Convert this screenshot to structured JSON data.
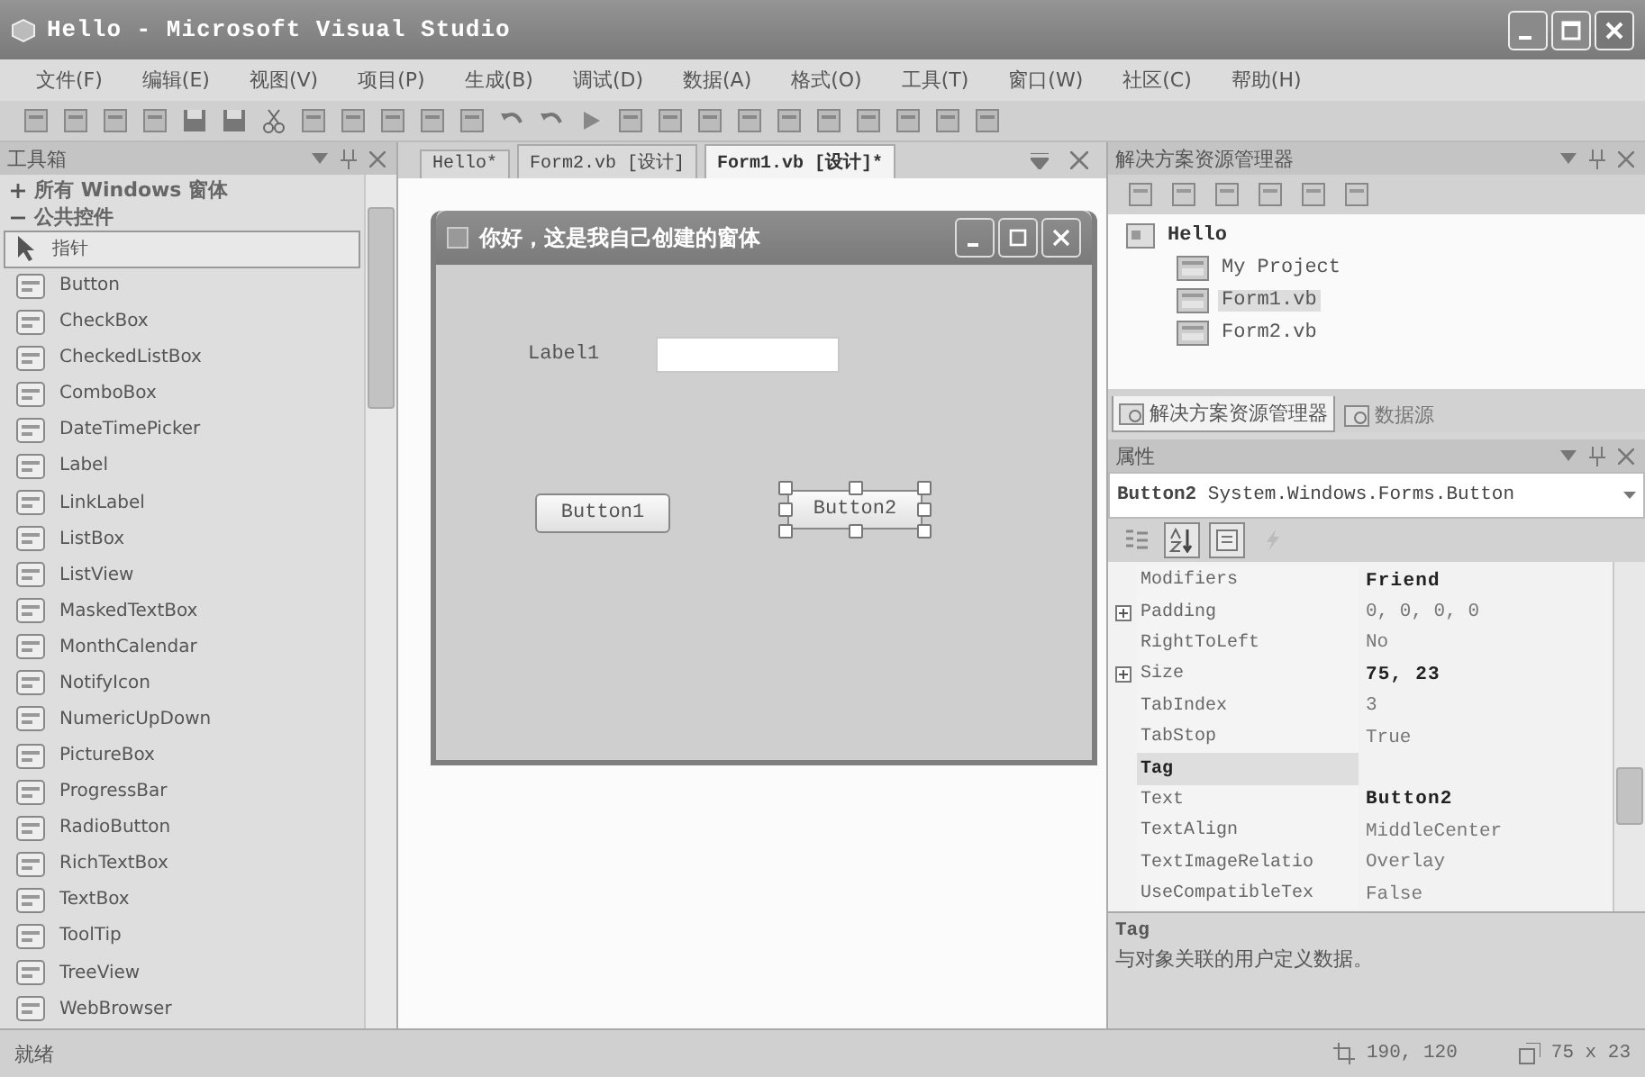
{
  "window": {
    "title": "Hello - Microsoft Visual Studio"
  },
  "menu": [
    "文件(F)",
    "编辑(E)",
    "视图(V)",
    "项目(P)",
    "生成(B)",
    "调试(D)",
    "数据(A)",
    "格式(O)",
    "工具(T)",
    "窗口(W)",
    "社区(C)",
    "帮助(H)"
  ],
  "toolbox": {
    "title": "工具箱",
    "groups": [
      {
        "label": "所有 Windows 窗体",
        "expanded": false
      },
      {
        "label": "公共控件",
        "expanded": true,
        "items": [
          {
            "label": "指针",
            "kind": "pointer",
            "selected": true
          },
          {
            "label": "Button",
            "kind": "control",
            "selected": false
          },
          {
            "label": "CheckBox",
            "kind": "control",
            "selected": false
          },
          {
            "label": "CheckedListBox",
            "kind": "control",
            "selected": false
          },
          {
            "label": "ComboBox",
            "kind": "control",
            "selected": false
          },
          {
            "label": "DateTimePicker",
            "kind": "control",
            "selected": false
          },
          {
            "label": "Label",
            "kind": "control",
            "selected": false
          },
          {
            "label": "LinkLabel",
            "kind": "control",
            "selected": false
          },
          {
            "label": "ListBox",
            "kind": "control",
            "selected": false
          },
          {
            "label": "ListView",
            "kind": "control",
            "selected": false
          },
          {
            "label": "MaskedTextBox",
            "kind": "control",
            "selected": false
          },
          {
            "label": "MonthCalendar",
            "kind": "control",
            "selected": false
          },
          {
            "label": "NotifyIcon",
            "kind": "control",
            "selected": false
          },
          {
            "label": "NumericUpDown",
            "kind": "control",
            "selected": false
          },
          {
            "label": "PictureBox",
            "kind": "control",
            "selected": false
          },
          {
            "label": "ProgressBar",
            "kind": "control",
            "selected": false
          },
          {
            "label": "RadioButton",
            "kind": "control",
            "selected": false
          },
          {
            "label": "RichTextBox",
            "kind": "control",
            "selected": false
          },
          {
            "label": "TextBox",
            "kind": "control",
            "selected": false
          },
          {
            "label": "ToolTip",
            "kind": "control",
            "selected": false
          },
          {
            "label": "TreeView",
            "kind": "control",
            "selected": false
          },
          {
            "label": "WebBrowser",
            "kind": "control",
            "selected": false
          }
        ]
      }
    ]
  },
  "tabs": [
    {
      "label": "Hello*",
      "selected": false
    },
    {
      "label": "Form2.vb [设计]",
      "selected": false
    },
    {
      "label": "Form1.vb [设计]*",
      "selected": true
    }
  ],
  "form": {
    "title": "你好，这是我自己创建的窗体",
    "controls": [
      {
        "kind": "label",
        "text": "Label1",
        "selected": false
      },
      {
        "kind": "textbox",
        "selected": false
      },
      {
        "kind": "button",
        "text": "Button1",
        "selected": false
      },
      {
        "kind": "button",
        "text": "Button2",
        "selected": true
      }
    ]
  },
  "solution_explorer": {
    "title": "解决方案资源管理器",
    "tree": [
      {
        "label": "Hello",
        "selected": false,
        "children": [
          {
            "label": "My Project",
            "selected": false
          },
          {
            "label": "Form1.vb",
            "selected": true
          },
          {
            "label": "Form2.vb",
            "selected": false
          }
        ]
      }
    ]
  },
  "panel_tabs": [
    {
      "label": "解决方案资源管理器",
      "selected": true
    },
    {
      "label": "数据源",
      "selected": false
    }
  ],
  "properties": {
    "title": "属性",
    "object": "**Button2** System.Windows.Forms.Button",
    "view_buttons": [
      {
        "kind": "categorized",
        "selected": false
      },
      {
        "kind": "alphabetical",
        "selected": true
      },
      {
        "kind": "properties",
        "selected": true
      },
      {
        "kind": "events",
        "selected": false
      }
    ],
    "rows": [
      {
        "name": "Modifiers",
        "value": "Friend",
        "expandable": false,
        "modified": true,
        "selected": false
      },
      {
        "name": "Padding",
        "value": "0, 0, 0, 0",
        "expandable": true,
        "modified": false,
        "selected": false
      },
      {
        "name": "RightToLeft",
        "value": "No",
        "expandable": false,
        "modified": false,
        "selected": false
      },
      {
        "name": "Size",
        "value": "75, 23",
        "expandable": true,
        "modified": true,
        "selected": false
      },
      {
        "name": "TabIndex",
        "value": "3",
        "expandable": false,
        "modified": false,
        "selected": false
      },
      {
        "name": "TabStop",
        "value": "True",
        "expandable": false,
        "modified": false,
        "selected": false
      },
      {
        "name": "Tag",
        "expandable": false,
        "selected": true
      },
      {
        "name": "Text",
        "value": "Button2",
        "expandable": false,
        "modified": true,
        "selected": false
      },
      {
        "name": "TextAlign",
        "value": "MiddleCenter",
        "expandable": false,
        "modified": false,
        "selected": false
      },
      {
        "name": "TextImageRelatio",
        "value": "Overlay",
        "expandable": false,
        "modified": false,
        "selected": false
      },
      {
        "name": "UseCompatibleTex",
        "value": "False",
        "expandable": false,
        "modified": false,
        "selected": false
      }
    ],
    "description": {
      "title": "Tag",
      "text": "与对象关联的用户定义数据。"
    }
  },
  "status_bar": {
    "text": "就绪",
    "location": "190, 120",
    "size": "75 x 23"
  }
}
